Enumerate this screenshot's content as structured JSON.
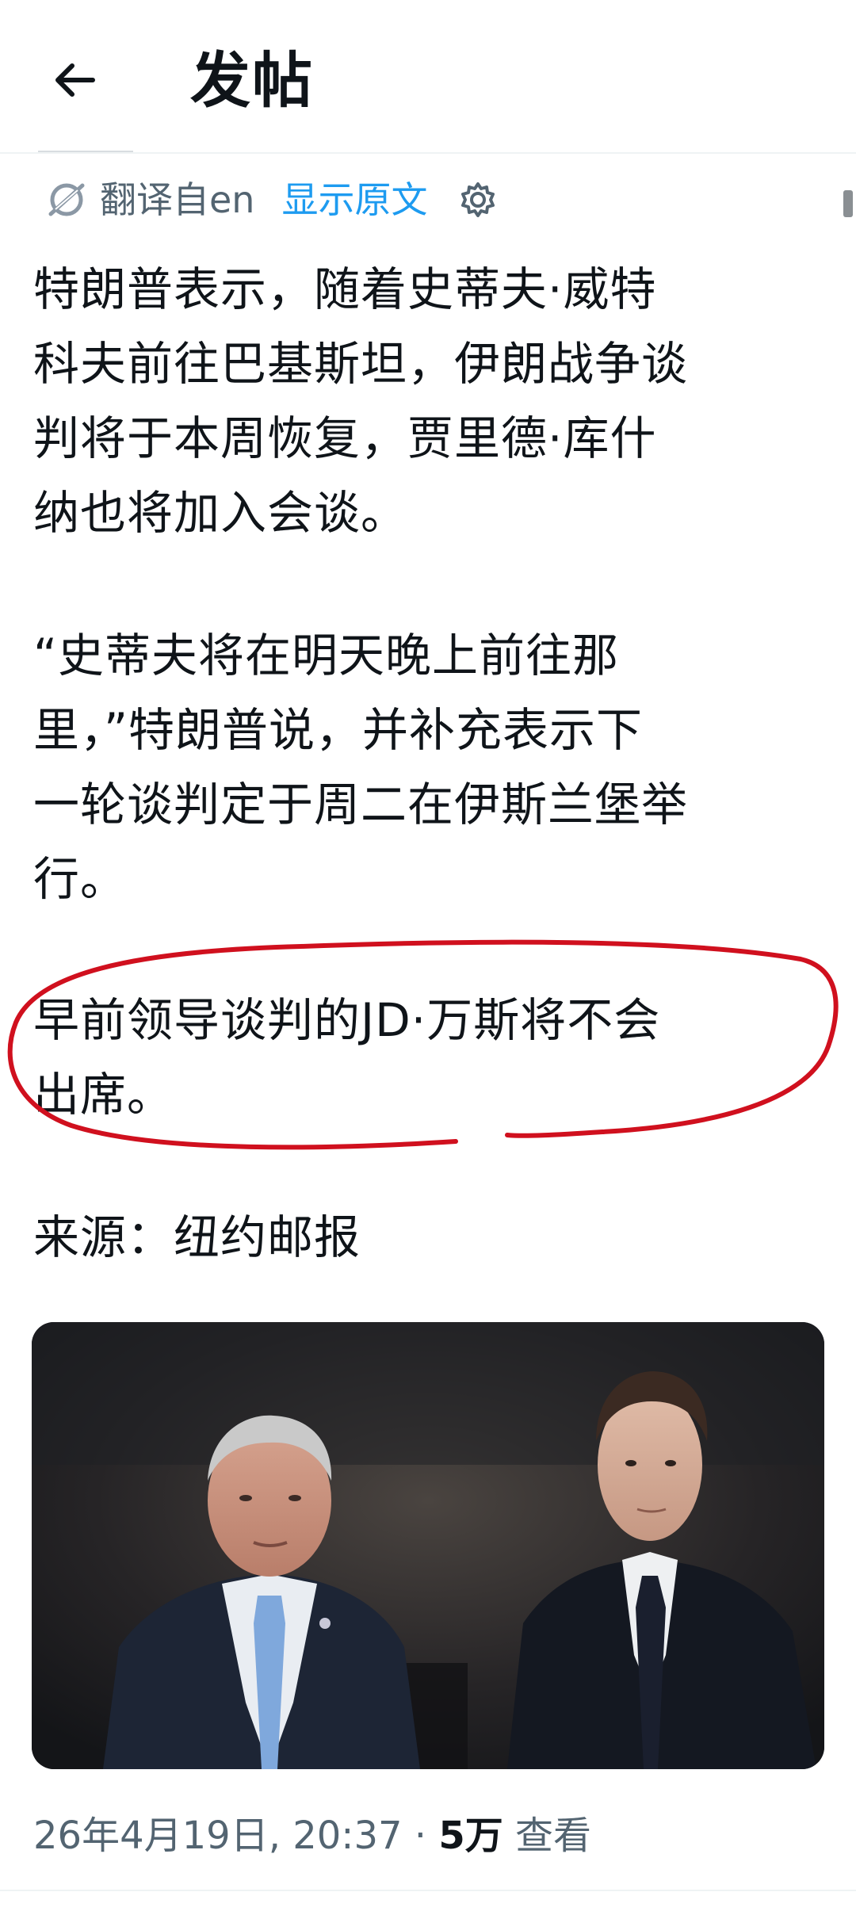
{
  "header": {
    "back_icon": "arrow-left-icon",
    "title": "发帖"
  },
  "translation": {
    "icon": "translate-icon",
    "label": "翻译自en",
    "show_original": "显示原文",
    "settings_icon": "gear-icon",
    "link_color": "#1d9bf0"
  },
  "post": {
    "paragraphs": [
      "特朗普表示，随着史蒂夫·威特\n科夫前往巴基斯坦，伊朗战争谈\n判将于本周恢复，贾里德·库什\n纳也将加入会谈。",
      "“史蒂夫将在明天晚上前往那\n里，”特朗普说，并补充表示下\n一轮谈判定于周二在伊斯兰堡举\n行。",
      "早前领导谈判的JD·万斯将不会\n出席。",
      "来源：纽约邮报"
    ],
    "highlight_color": "#d0101e"
  },
  "media": {
    "icon": "photo-two-men-seated-interview"
  },
  "meta": {
    "timestamp": "26年4月19日, 20:37 · ",
    "views_count": "5万",
    "views_label": " 查看"
  }
}
